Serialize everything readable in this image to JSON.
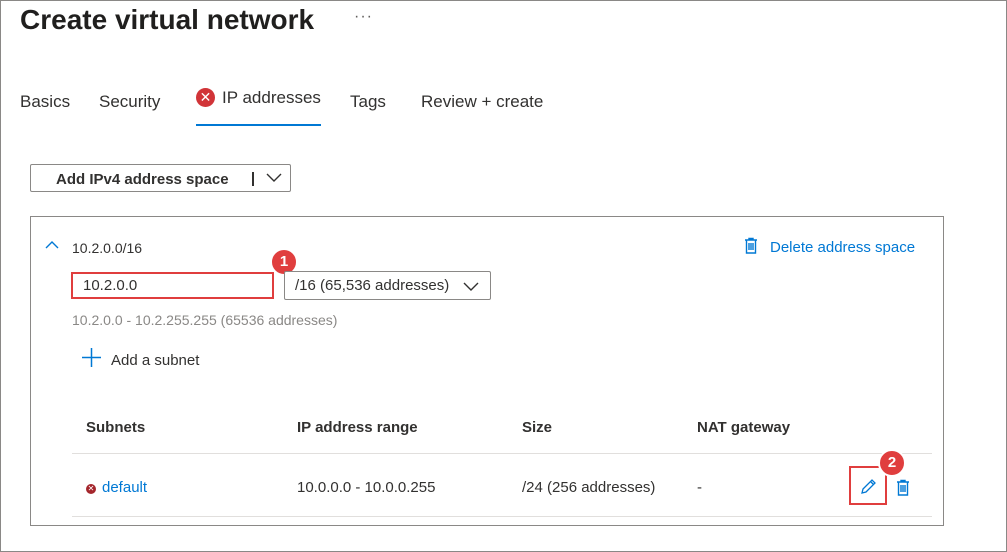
{
  "page": {
    "title": "Create virtual network",
    "more_label": "···"
  },
  "tabs": [
    {
      "label": "Basics"
    },
    {
      "label": "Security"
    },
    {
      "label": "IP addresses",
      "error_glyph": "✕"
    },
    {
      "label": "Tags"
    },
    {
      "label": "Review + create"
    }
  ],
  "toolbar": {
    "add_space_label": "Add IPv4 address space"
  },
  "address_space": {
    "cidr": "10.2.0.0/16",
    "address_value": "10.2.0.0",
    "prefix_value": "/16 (65,536 addresses)",
    "range_text": "10.2.0.0 - 10.2.255.255 (65536 addresses)",
    "delete_label": "Delete address space",
    "add_subnet_label": "Add a subnet"
  },
  "subnets_table": {
    "headers": [
      "Subnets",
      "IP address range",
      "Size",
      "NAT gateway"
    ],
    "rows": [
      {
        "name": "default",
        "error_glyph": "✕",
        "range": "10.0.0.0 - 10.0.0.255",
        "size": "/24 (256 addresses)",
        "nat": "-"
      }
    ]
  },
  "callouts": {
    "one": "1",
    "two": "2"
  },
  "colors": {
    "accent": "#0078d4",
    "error": "#d13438",
    "callout": "#e03e3e"
  },
  "icons": [
    "more-icon",
    "error-icon",
    "chevron-down-icon",
    "chevron-up-icon",
    "trash-icon",
    "plus-icon",
    "pencil-icon"
  ]
}
